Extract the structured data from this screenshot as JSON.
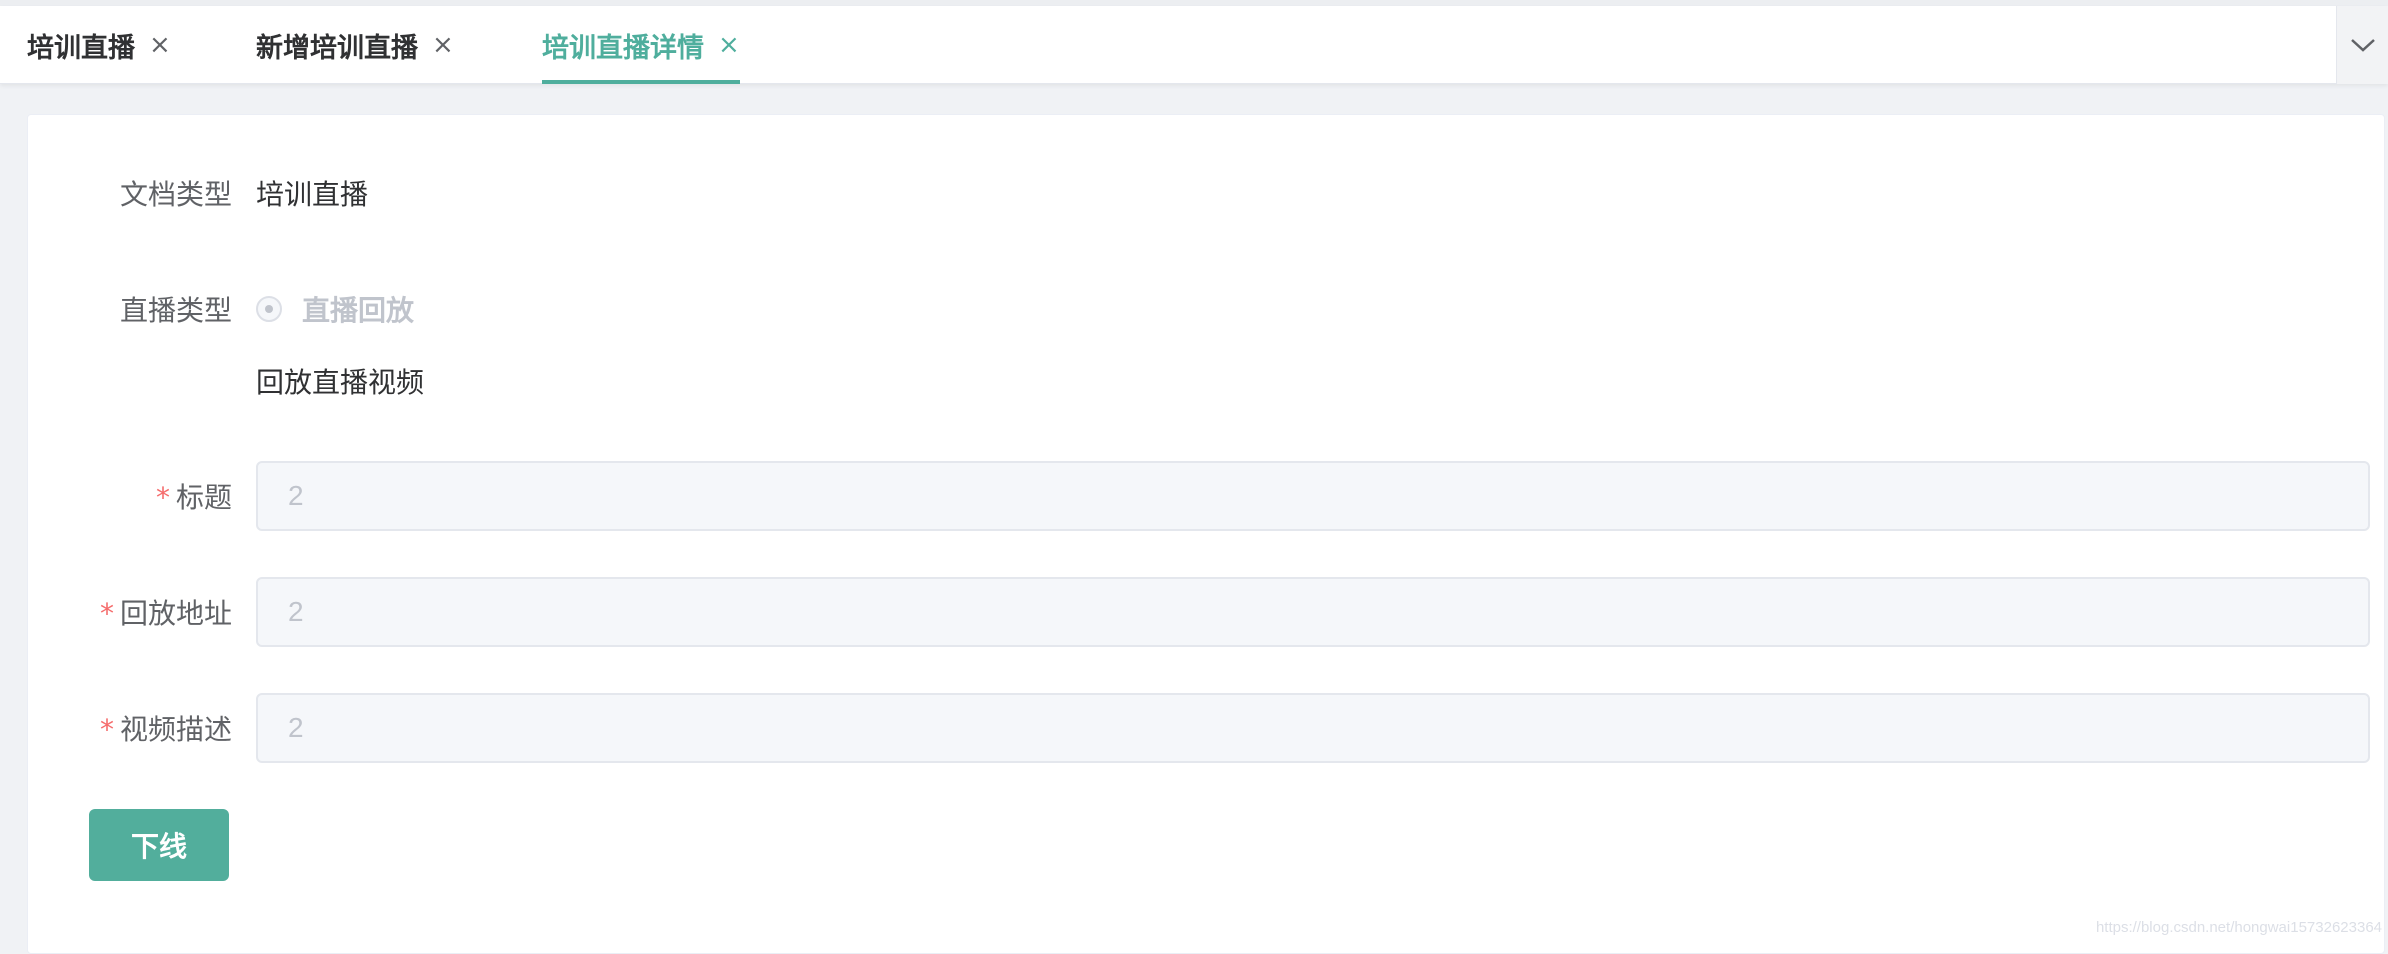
{
  "tabs": [
    {
      "label": "培训直播",
      "close": "×"
    },
    {
      "label": "新增培训直播",
      "close": "×"
    },
    {
      "label": "培训直播详情",
      "close": "×",
      "active": true
    }
  ],
  "tab_menu_icon": "chevron-down-icon",
  "form": {
    "doc_type": {
      "label": "文档类型",
      "value": "培训直播"
    },
    "live_type": {
      "label": "直播类型",
      "option": "直播回放",
      "subtext": "回放直播视频"
    },
    "title": {
      "required": "*",
      "label": "标题",
      "value": "2"
    },
    "replay_url": {
      "required": "*",
      "label": "回放地址",
      "value": "2"
    },
    "video_desc": {
      "required": "*",
      "label": "视频描述",
      "value": "2"
    }
  },
  "offline_button": "下线",
  "watermark": "https://blog.csdn.net/hongwai15732623364",
  "colors": {
    "accent": "#4fae9d",
    "required": "#f56c6c",
    "disabled_text": "#c0c4cc"
  }
}
